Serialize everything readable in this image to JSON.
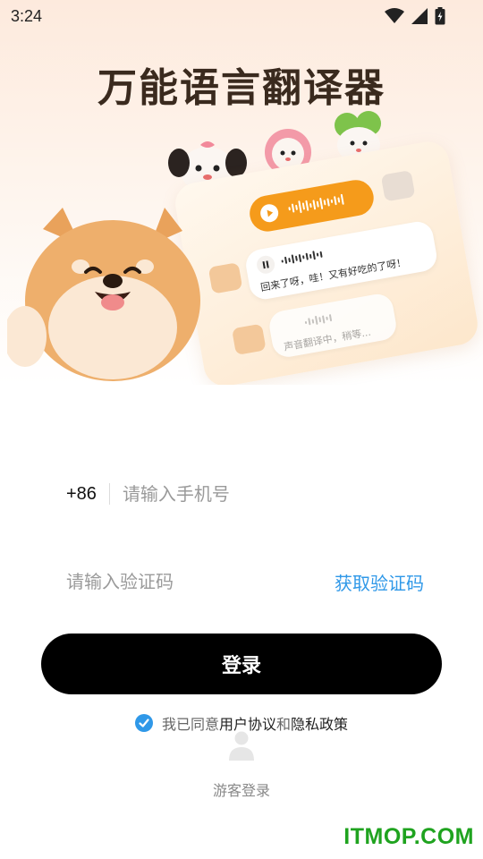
{
  "status_bar": {
    "time": "3:24",
    "icons": [
      "wifi-icon",
      "signal-icon",
      "battery-icon"
    ]
  },
  "hero": {
    "title": "万能语言翻译器",
    "chat": {
      "message_1": "回来了呀，哇！又有好吃的了呀！",
      "message_2": "声音翻译中，稍等..."
    }
  },
  "login_form": {
    "country_code": "+86",
    "phone_placeholder": "请输入手机号",
    "code_placeholder": "请输入验证码",
    "get_code_label": "获取验证码",
    "login_label": "登录",
    "agreement": {
      "prefix": "我已同意",
      "user_agreement": "用户协议",
      "and": "和",
      "privacy_policy": "隐私政策",
      "checked": true
    },
    "guest_login_label": "游客登录"
  },
  "watermark": "ITMOP.COM",
  "colors": {
    "accent": "#2f98e8",
    "button": "#000000",
    "orange": "#f59b1b",
    "watermark": "#1fa31f"
  }
}
